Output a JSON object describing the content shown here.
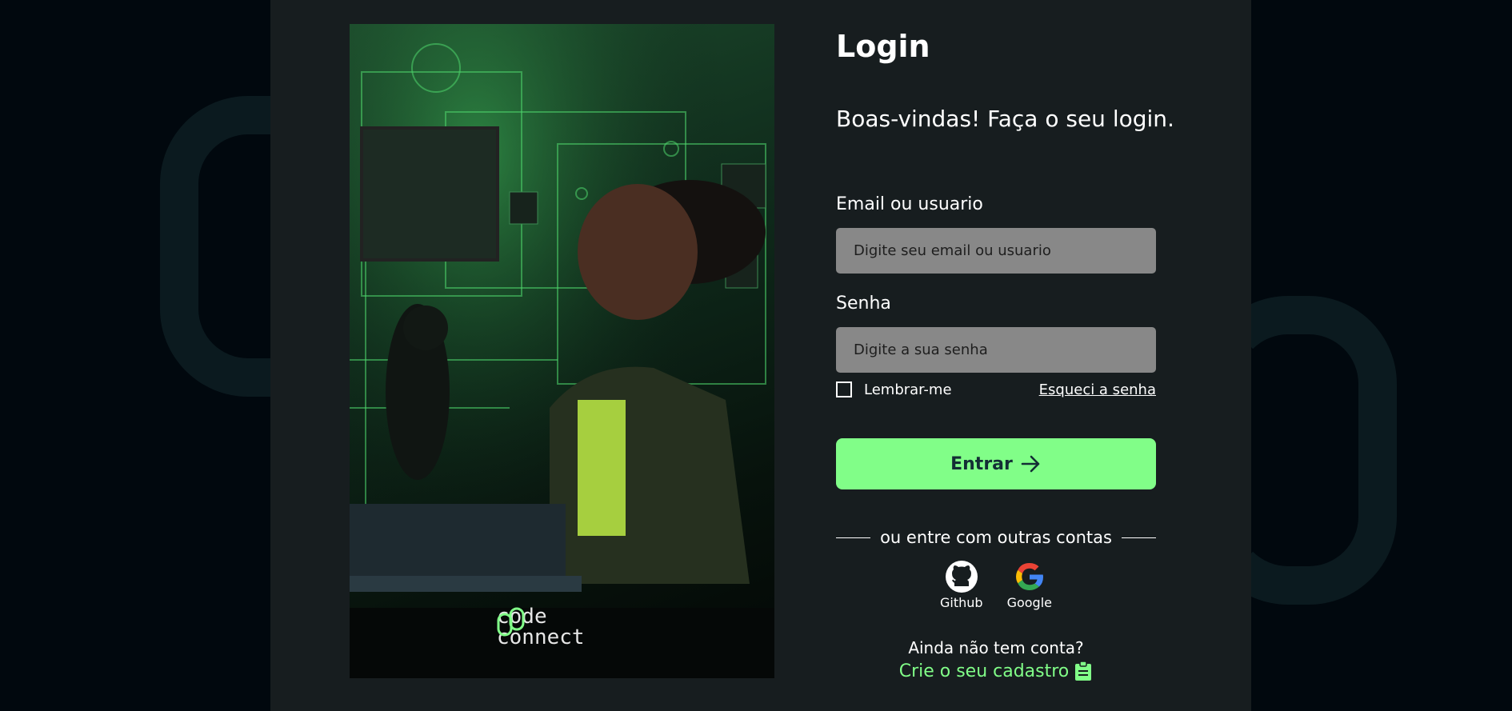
{
  "hero": {
    "brand_line1": "code",
    "brand_line2": "connect"
  },
  "login": {
    "title": "Login",
    "subtitle": "Boas-vindas! Faça o seu login.",
    "email_label": "Email ou usuario",
    "email_placeholder": "Digite seu email ou usuario",
    "password_label": "Senha",
    "password_placeholder": "Digite a sua senha",
    "remember_label": "Lembrar-me",
    "forgot_label": "Esqueci a senha",
    "submit_label": "Entrar",
    "divider_text": "ou entre com outras contas"
  },
  "social": [
    {
      "name": "Github",
      "icon": "github-icon"
    },
    {
      "name": "Google",
      "icon": "google-icon"
    }
  ],
  "signup": {
    "prompt": "Ainda não tem conta?",
    "link_label": "Crie o seu cadastro",
    "icon": "clipboard-icon"
  },
  "colors": {
    "accent": "#81fe88",
    "panel": "#171d1f",
    "background": "#01080e",
    "input": "#888888",
    "button_text": "#132e35"
  }
}
